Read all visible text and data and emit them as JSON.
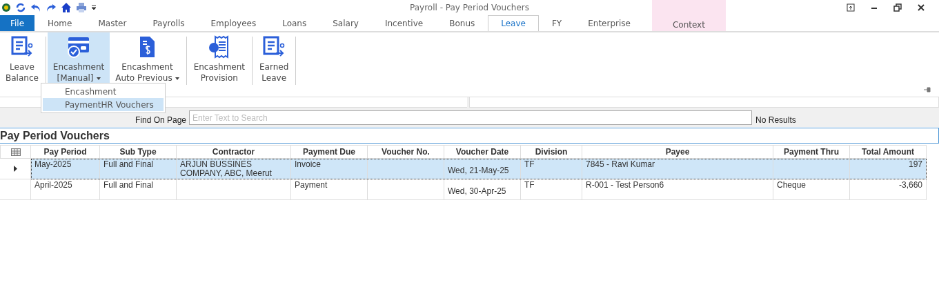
{
  "window": {
    "title": "Payroll - Pay Period Vouchers"
  },
  "tabs": [
    {
      "label": "File",
      "kind": "file",
      "selected": false
    },
    {
      "label": "Home",
      "kind": "tab",
      "selected": false
    },
    {
      "label": "Master",
      "kind": "tab",
      "selected": false
    },
    {
      "label": "Payrolls",
      "kind": "tab",
      "selected": false
    },
    {
      "label": "Employees",
      "kind": "tab",
      "selected": false
    },
    {
      "label": "Loans",
      "kind": "tab",
      "selected": false
    },
    {
      "label": "Salary",
      "kind": "tab",
      "selected": false
    },
    {
      "label": "Incentive",
      "kind": "tab",
      "selected": false
    },
    {
      "label": "Bonus",
      "kind": "tab",
      "selected": false
    },
    {
      "label": "Leave",
      "kind": "tab",
      "selected": true
    },
    {
      "label": "FY",
      "kind": "tab",
      "selected": false
    },
    {
      "label": "Enterprise",
      "kind": "tab",
      "selected": false
    },
    {
      "label": "Context",
      "kind": "context",
      "selected": false
    }
  ],
  "ribbon": [
    {
      "lines": [
        "Leave",
        "Balance"
      ],
      "dropdown": false,
      "selected": false
    },
    {
      "lines": [
        "Encashment",
        "[Manual]"
      ],
      "dropdown": true,
      "selected": true
    },
    {
      "lines": [
        "Encashment",
        "Auto Previous"
      ],
      "dropdown": true,
      "selected": false
    },
    {
      "lines": [
        "Encashment",
        "Provision"
      ],
      "dropdown": false,
      "selected": false
    },
    {
      "lines": [
        "Earned",
        "Leave"
      ],
      "dropdown": false,
      "selected": false
    }
  ],
  "dropdown_menu": [
    {
      "label": "Encashment",
      "selected": false
    },
    {
      "label": "PaymentHR Vouchers",
      "selected": true
    }
  ],
  "find_bar": {
    "label": "Find On Page",
    "placeholder": "Enter Text to Search",
    "result": "No Results"
  },
  "grid": {
    "title": "Pay Period Vouchers",
    "columns": [
      "Pay Period",
      "Sub Type",
      "Contractor",
      "Payment Due",
      "Voucher No.",
      "Voucher Date",
      "Division",
      "Payee",
      "Payment Thru",
      "Total Amount"
    ],
    "rows": [
      {
        "selected": true,
        "cells": [
          "May-2025",
          "Full and Final",
          "ARJUN BUSSINES COMPANY, ABC, Meerut",
          "Invoice",
          "",
          "Wed, 21-May-25",
          "TF",
          "7845 - Ravi Kumar",
          "",
          "197"
        ]
      },
      {
        "selected": false,
        "cells": [
          "April-2025",
          "Full and Final",
          "",
          "Payment",
          "",
          "Wed, 30-Apr-25",
          "TF",
          "R-001 - Test Person6",
          "Cheque",
          "-3,660"
        ]
      }
    ]
  }
}
